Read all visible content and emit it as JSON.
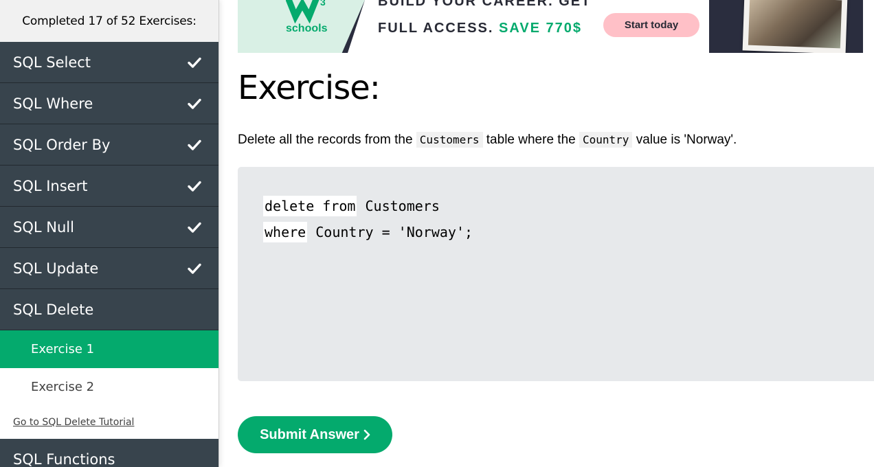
{
  "sidebar": {
    "progress_text": "Completed 17 of 52 Exercises:",
    "categories": [
      {
        "label": "SQL Select",
        "completed": true
      },
      {
        "label": "SQL Where",
        "completed": true
      },
      {
        "label": "SQL Order By",
        "completed": true
      },
      {
        "label": "SQL Insert",
        "completed": true
      },
      {
        "label": "SQL Null",
        "completed": true
      },
      {
        "label": "SQL Update",
        "completed": true
      },
      {
        "label": "SQL Delete",
        "completed": false
      }
    ],
    "sub_items": [
      {
        "label": "Exercise 1",
        "selected": true
      },
      {
        "label": "Exercise 2",
        "selected": false
      }
    ],
    "tutorial_link": "Go to SQL Delete Tutorial",
    "next_category": "SQL Functions"
  },
  "banner": {
    "logo_text": "schools",
    "logo_superscript": "3",
    "headline_line1": "BUILD YOUR CAREER. GET",
    "headline_line2": "FULL ACCESS.",
    "headline_save": "SAVE 770$",
    "button_label": "Start today"
  },
  "main": {
    "title": "Exercise:",
    "instruction": {
      "part1": "Delete all the records from the",
      "code1": "Customers",
      "part2": "table where the",
      "code2": "Country",
      "part3": "value is 'Norway'."
    },
    "code": {
      "line1_blank": "delete from",
      "line1_rest": " Customers",
      "line2_blank": "where",
      "line2_rest": " Country = 'Norway';"
    },
    "submit_label": "Submit Answer"
  },
  "colors": {
    "sidebar_bg": "#38444d",
    "accent_green": "#04aa6d",
    "editor_bg": "#e7e9eb",
    "banner_button": "#ffc0c7"
  }
}
